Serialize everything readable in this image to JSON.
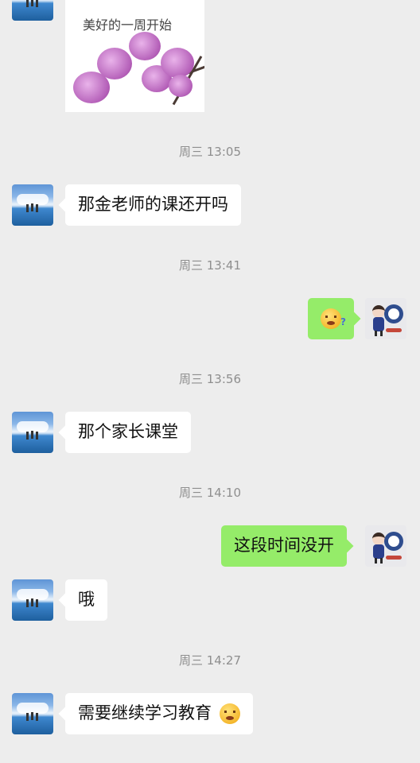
{
  "image_message": {
    "caption": "美好的一周开始"
  },
  "messages": [
    {
      "type": "time",
      "text": "周三 13:05"
    },
    {
      "type": "text",
      "side": "left",
      "text": "那金老师的课还开吗"
    },
    {
      "type": "time",
      "text": "周三 13:41"
    },
    {
      "type": "sticker",
      "side": "right",
      "icon": "thinking-face-emoji"
    },
    {
      "type": "time",
      "text": "周三 13:56"
    },
    {
      "type": "text",
      "side": "left",
      "text": "那个家长课堂"
    },
    {
      "type": "time",
      "text": "周三 14:10"
    },
    {
      "type": "text",
      "side": "right",
      "text": "这段时间没开"
    },
    {
      "type": "text",
      "side": "left",
      "text": "哦"
    },
    {
      "type": "time",
      "text": "周三 14:27"
    },
    {
      "type": "text",
      "side": "left",
      "text": "需要继续学习教育",
      "emoji": "laughing-crying-face"
    }
  ],
  "colors": {
    "background": "#ededed",
    "left_bubble": "#ffffff",
    "right_bubble": "#95ec69",
    "timestamp": "#8e8e8e"
  }
}
